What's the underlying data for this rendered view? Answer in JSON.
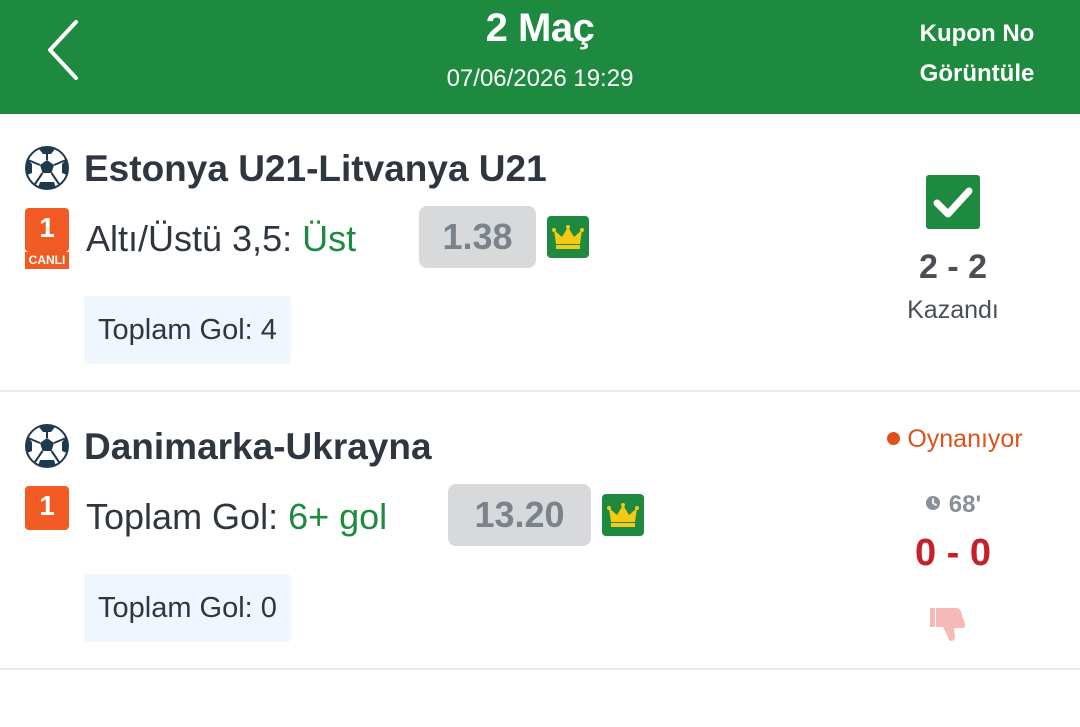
{
  "header": {
    "title": "2 Maç",
    "date": "07/06/2026 19:29",
    "right_line1": "Kupon No",
    "right_line2": "Görüntüle"
  },
  "colors": {
    "brand_green": "#1e8a3f",
    "live_orange": "#f15a22",
    "score_red": "#c6202a"
  },
  "matches": [
    {
      "name": "Estonya U21-Litvanya U21",
      "badge_number": "1",
      "badge_label": "CANLI",
      "market_label": "Altı/Üstü 3,5:",
      "pick": "Üst",
      "odds": "1.38",
      "info": "Toplam Gol: 4",
      "score": "2 - 2",
      "result": "Kazandı",
      "status_icon": "check-icon"
    },
    {
      "name": "Danimarka-Ukrayna",
      "badge_number": "1",
      "market_label": "Toplam Gol:",
      "pick": "6+ gol",
      "odds": "13.20",
      "info": "Toplam Gol: 0",
      "live_status": "Oynanıyor",
      "minute": "68'",
      "score": "0 - 0",
      "status_icon": "thumb-down-icon"
    }
  ]
}
